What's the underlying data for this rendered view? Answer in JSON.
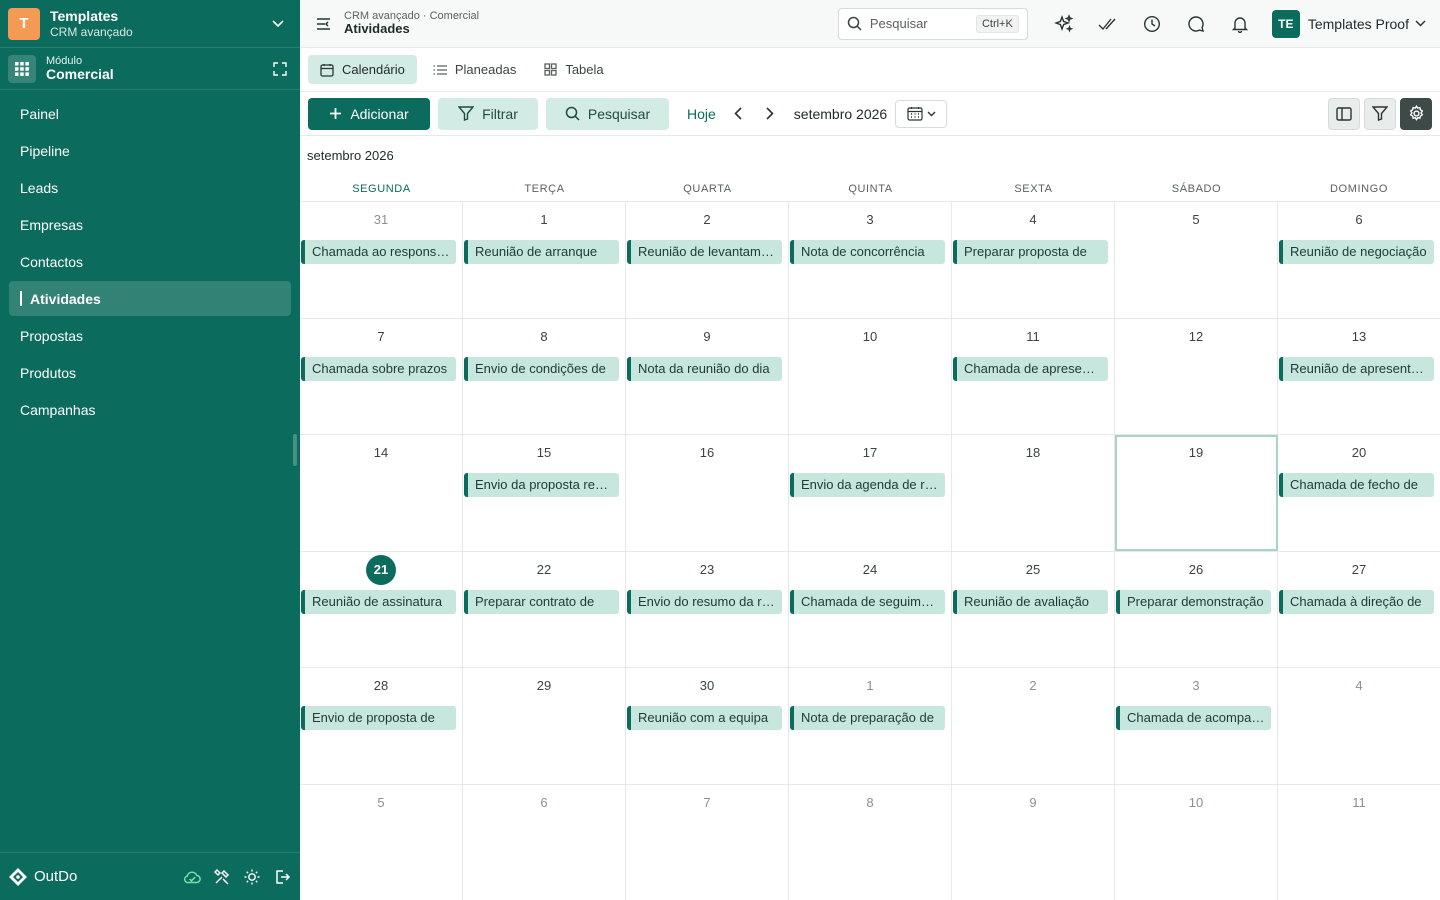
{
  "workspace": {
    "initial": "T",
    "title": "Templates",
    "subtitle": "CRM avançado"
  },
  "module": {
    "label": "Módulo",
    "name": "Comercial"
  },
  "nav": {
    "items": [
      {
        "label": "Painel"
      },
      {
        "label": "Pipeline"
      },
      {
        "label": "Leads"
      },
      {
        "label": "Empresas"
      },
      {
        "label": "Contactos"
      },
      {
        "label": "Atividades",
        "active": true
      },
      {
        "label": "Propostas"
      },
      {
        "label": "Produtos"
      },
      {
        "label": "Campanhas"
      }
    ]
  },
  "footer": {
    "brand": "OutDo"
  },
  "topbar": {
    "path": "CRM avançado · Comercial",
    "title": "Atividades",
    "search_placeholder": "Pesquisar",
    "shortcut": "Ctrl+K",
    "user_initials": "TE",
    "user_name": "Templates Proof"
  },
  "tabs": [
    {
      "label": "Calendário",
      "active": true
    },
    {
      "label": "Planeadas"
    },
    {
      "label": "Tabela"
    }
  ],
  "toolbar": {
    "add_label": "Adicionar",
    "filter_label": "Filtrar",
    "search_label": "Pesquisar",
    "today_label": "Hoje",
    "month_label": "setembro 2026"
  },
  "calendar": {
    "title": "setembro 2026",
    "weekdays": [
      "SEGUNDA",
      "TERÇA",
      "QUARTA",
      "QUINTA",
      "SEXTA",
      "SÁBADO",
      "DOMINGO"
    ],
    "weeks": [
      [
        {
          "day": "31",
          "other": true,
          "event": "Chamada ao responsável"
        },
        {
          "day": "1",
          "event": "Reunião de arranque"
        },
        {
          "day": "2",
          "event": "Reunião de levantamento"
        },
        {
          "day": "3",
          "event": "Nota de concorrência"
        },
        {
          "day": "4",
          "event": "Preparar proposta de"
        },
        {
          "day": "5"
        },
        {
          "day": "6",
          "event": "Reunião de negociação"
        }
      ],
      [
        {
          "day": "7",
          "event": "Chamada sobre prazos"
        },
        {
          "day": "8",
          "event": "Envio de condições de"
        },
        {
          "day": "9",
          "event": "Nota da reunião do dia"
        },
        {
          "day": "10"
        },
        {
          "day": "11",
          "event": "Chamada de apresentação"
        },
        {
          "day": "12"
        },
        {
          "day": "13",
          "event": "Reunião de apresentação"
        }
      ],
      [
        {
          "day": "14"
        },
        {
          "day": "15",
          "event": "Envio da proposta revista"
        },
        {
          "day": "16"
        },
        {
          "day": "17",
          "event": "Envio da agenda de reunião"
        },
        {
          "day": "18"
        },
        {
          "day": "19",
          "selected": true
        },
        {
          "day": "20",
          "event": "Chamada de fecho de"
        }
      ],
      [
        {
          "day": "21",
          "today": true,
          "event": "Reunião de assinatura"
        },
        {
          "day": "22",
          "event": "Preparar contrato de"
        },
        {
          "day": "23",
          "event": "Envio do resumo da reunião"
        },
        {
          "day": "24",
          "event": "Chamada de seguimento"
        },
        {
          "day": "25",
          "event": "Reunião de avaliação"
        },
        {
          "day": "26",
          "event": "Preparar demonstração"
        },
        {
          "day": "27",
          "event": "Chamada à direção de"
        }
      ],
      [
        {
          "day": "28",
          "event": "Envio de proposta de"
        },
        {
          "day": "29"
        },
        {
          "day": "30",
          "event": "Reunião com a equipa"
        },
        {
          "day": "1",
          "other": true,
          "event": "Nota de preparação de"
        },
        {
          "day": "2",
          "other": true
        },
        {
          "day": "3",
          "other": true,
          "event": "Chamada de acompanhamento"
        },
        {
          "day": "4",
          "other": true
        }
      ],
      [
        {
          "day": "5",
          "other": true
        },
        {
          "day": "6",
          "other": true
        },
        {
          "day": "7",
          "other": true
        },
        {
          "day": "8",
          "other": true
        },
        {
          "day": "9",
          "other": true
        },
        {
          "day": "10",
          "other": true
        },
        {
          "day": "11",
          "other": true
        }
      ]
    ]
  },
  "colors": {
    "brand": "#0b6b5c",
    "accent": "#f59a55",
    "event_bg": "#c6e6de"
  }
}
